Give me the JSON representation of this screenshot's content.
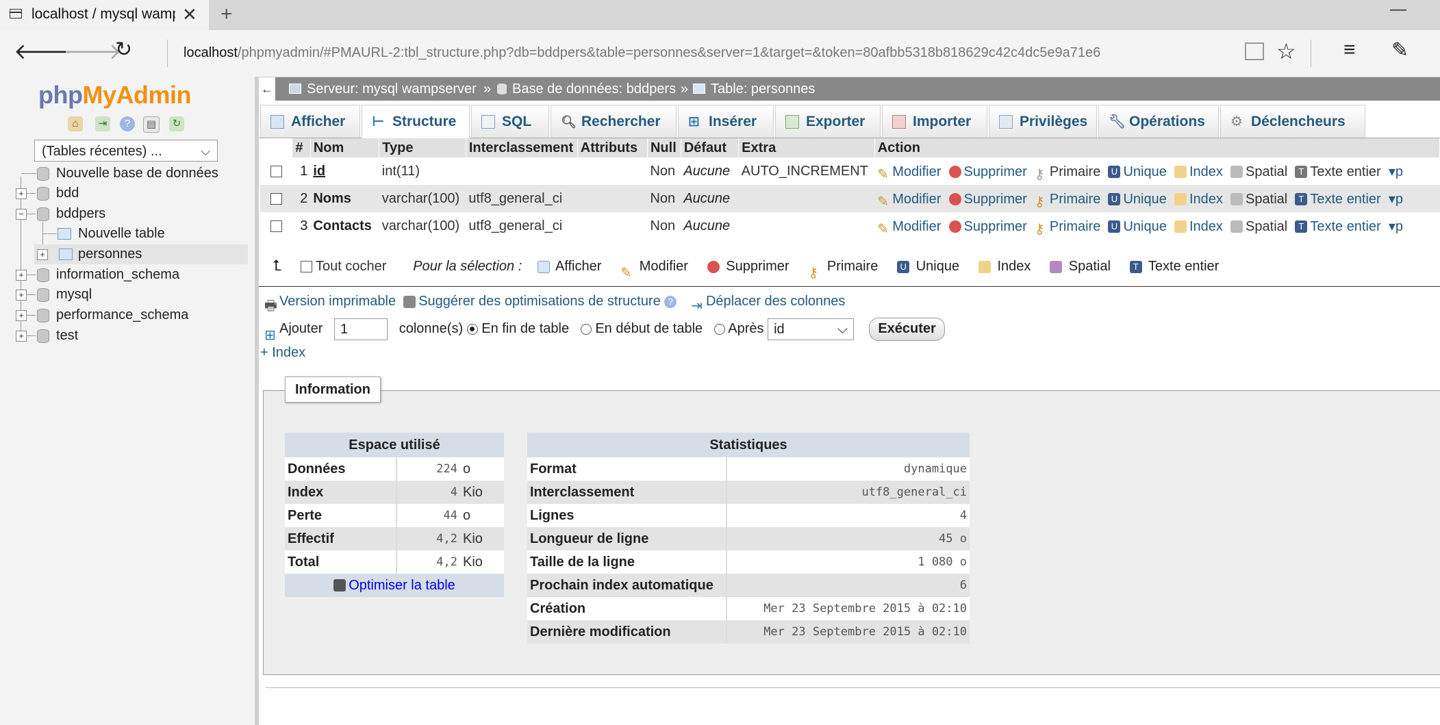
{
  "browser": {
    "tab_title": "localhost / mysql wamps",
    "url_host": "localhost",
    "url_path": "/phpmyadmin/#PMAURL-2:tbl_structure.php?db=bddpers&table=personnes&server=1&target=&token=80afbb5318b818629c42c4dc5e9a71e6"
  },
  "sidebar": {
    "logo": {
      "php": "php",
      "my": "My",
      "admin": "Admin"
    },
    "recent_tables": "(Tables récentes) ...",
    "tree": [
      {
        "label": "Nouvelle base de données"
      },
      {
        "label": "bdd"
      },
      {
        "label": "bddpers"
      },
      {
        "label": "Nouvelle table"
      },
      {
        "label": "personnes"
      },
      {
        "label": "information_schema"
      },
      {
        "label": "mysql"
      },
      {
        "label": "performance_schema"
      },
      {
        "label": "test"
      }
    ]
  },
  "breadcrumb": {
    "server": "Serveur: mysql wampserver",
    "sep1": "»",
    "database": "Base de données: bddpers",
    "sep2": "»",
    "table": "Table: personnes"
  },
  "tabs": [
    "Afficher",
    "Structure",
    "SQL",
    "Rechercher",
    "Insérer",
    "Exporter",
    "Importer",
    "Privilèges",
    "Opérations",
    "Déclencheurs"
  ],
  "structure": {
    "headers": [
      "#",
      "Nom",
      "Type",
      "Interclassement",
      "Attributs",
      "Null",
      "Défaut",
      "Extra",
      "Action"
    ],
    "rows": [
      {
        "num": "1",
        "name": "id",
        "type": "int(11)",
        "collation": "",
        "attributes": "",
        "null": "Non",
        "default": "Aucune",
        "extra": "AUTO_INCREMENT"
      },
      {
        "num": "2",
        "name": "Noms",
        "type": "varchar(100)",
        "collation": "utf8_general_ci",
        "attributes": "",
        "null": "Non",
        "default": "Aucune",
        "extra": ""
      },
      {
        "num": "3",
        "name": "Contacts",
        "type": "varchar(100)",
        "collation": "utf8_general_ci",
        "attributes": "",
        "null": "Non",
        "default": "Aucune",
        "extra": ""
      }
    ],
    "actions": [
      "Modifier",
      "Supprimer",
      "Primaire",
      "Unique",
      "Index",
      "Spatial",
      "Texte entier",
      "p"
    ]
  },
  "selection": {
    "check_all": "Tout cocher",
    "for_selection": "Pour la sélection :",
    "actions": [
      "Afficher",
      "Modifier",
      "Supprimer",
      "Primaire",
      "Unique",
      "Index",
      "Spatial",
      "Texte entier"
    ]
  },
  "tools": {
    "printable": "Version imprimable",
    "suggest": "Suggérer des optimisations de structure",
    "move_cols": "Déplacer des colonnes"
  },
  "add_column": {
    "label": "Ajouter",
    "count": "1",
    "columns": "colonne(s)",
    "end": "En fin de table",
    "start": "En début de table",
    "after": "Après",
    "after_field": "id",
    "execute": "Exécuter"
  },
  "add_index": "+ Index",
  "information": {
    "legend": "Information",
    "space": {
      "title": "Espace utilisé",
      "rows": [
        {
          "k": "Données",
          "v": "224",
          "u": "o"
        },
        {
          "k": "Index",
          "v": "4",
          "u": "Kio"
        },
        {
          "k": "Perte",
          "v": "44",
          "u": "o"
        },
        {
          "k": "Effectif",
          "v": "4,2",
          "u": "Kio"
        },
        {
          "k": "Total",
          "v": "4,2",
          "u": "Kio"
        }
      ],
      "optimize": "Optimiser la table"
    },
    "stats": {
      "title": "Statistiques",
      "rows": [
        {
          "k": "Format",
          "v": "dynamique"
        },
        {
          "k": "Interclassement",
          "v": "utf8_general_ci"
        },
        {
          "k": "Lignes",
          "v": "4"
        },
        {
          "k": "Longueur de ligne",
          "v": "45 o"
        },
        {
          "k": "Taille de la ligne",
          "v": "1 080 o"
        },
        {
          "k": "Prochain index automatique",
          "v": "6"
        },
        {
          "k": "Création",
          "v": "Mer 23 Septembre 2015 à 02:10"
        },
        {
          "k": "Dernière modification",
          "v": "Mer 23 Septembre 2015 à 02:10"
        }
      ]
    }
  }
}
